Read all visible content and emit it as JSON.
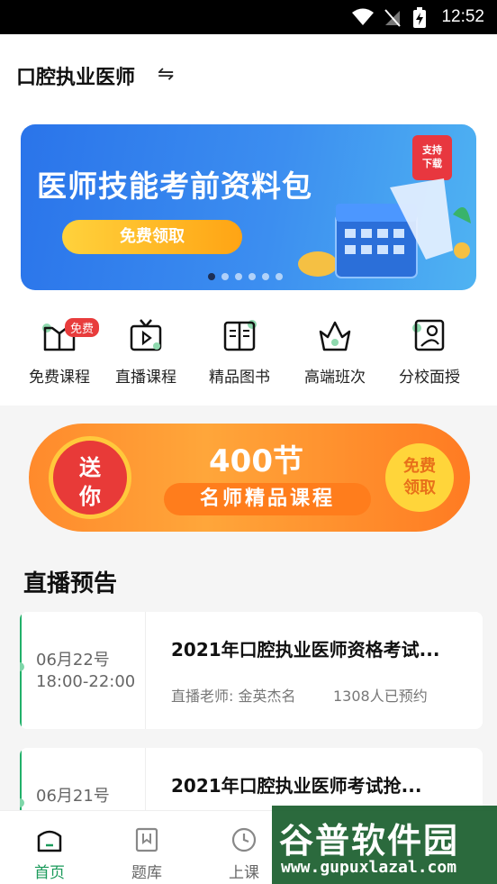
{
  "status_bar": {
    "time": "12:52"
  },
  "header": {
    "title": "口腔执业医师"
  },
  "banner": {
    "title": "医师技能考前资料包",
    "button": "免费领取",
    "tag_line1": "支持",
    "tag_line2": "下载",
    "slide_count": 6,
    "active_slide": 0
  },
  "nav": {
    "items": [
      {
        "label": "免费课程",
        "icon": "open-book-icon",
        "badge": "免费"
      },
      {
        "label": "直播课程",
        "icon": "tv-play-icon"
      },
      {
        "label": "精品图书",
        "icon": "book-pages-icon"
      },
      {
        "label": "高端班次",
        "icon": "crown-icon"
      },
      {
        "label": "分校面授",
        "icon": "classroom-icon"
      }
    ]
  },
  "promo": {
    "left_top": "送",
    "left_bottom": "你",
    "headline": "400节",
    "subline": "名师精品课程",
    "button_line1": "免费",
    "button_line2": "领取"
  },
  "live": {
    "section_title": "直播预告",
    "cards": [
      {
        "date": "06月22号",
        "time": "18:00-22:00",
        "title": "2021年口腔执业医师资格考试...",
        "teacher": "直播老师: 金英杰名",
        "count": "1308人已预约"
      },
      {
        "date": "06月21号",
        "time": "",
        "title": "2021年口腔执业医师考试抢...",
        "teacher": "",
        "count": ""
      }
    ]
  },
  "tabbar": {
    "tabs": [
      {
        "label": "首页",
        "icon": "home-icon",
        "active": true
      },
      {
        "label": "题库",
        "icon": "bookmark-icon",
        "active": false
      },
      {
        "label": "上课",
        "icon": "clock-icon",
        "active": false
      }
    ]
  },
  "watermark": {
    "name": "谷普软件园",
    "url": "www.gupuxlazal.com"
  },
  "colors": {
    "accent": "#1a9a5a",
    "banner_blue": "#2a74ea",
    "promo_orange": "#ff8a2c",
    "badge_red": "#e83c3c"
  }
}
